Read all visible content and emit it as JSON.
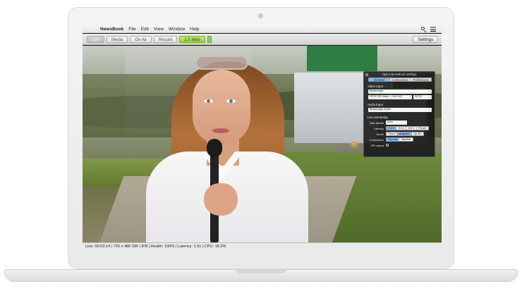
{
  "menubar": {
    "app_name": "NewsBook",
    "items": [
      "File",
      "Edit",
      "View",
      "Window",
      "Help"
    ]
  },
  "toolbar": {
    "live_label": "Live",
    "media_label": "Media",
    "on_air_label": "On Air",
    "record_label": "Record",
    "bitrate_label": "2.5 Mb/s",
    "settings_label": "Settings"
  },
  "settings_panel": {
    "title": "Tajero NewsBook Settings",
    "tabs": [
      "General",
      "Connections",
      "Preferences"
    ],
    "active_tab": "General",
    "video_input": {
      "heading": "Video input",
      "device": "Blackmagic",
      "format": "NTSC SD Video - YUV 422",
      "standard": "NTSC"
    },
    "audio_input": {
      "heading": "Audio input",
      "device": "Blackmagic Audio"
    },
    "live_streaming": {
      "heading": "Live streaming",
      "max_bitrate_label": "Max bitrate",
      "max_bitrate_value": "Auto",
      "latency_label": "Latency",
      "latency_options": [
        "1.5 s",
        "3.0 s",
        "8.0 s",
        "Preset"
      ],
      "latency_selected": "1.5 s",
      "mode_label": "Mode",
      "mode_options": [
        "Fixed",
        "Adaptive",
        "Up-Ro"
      ],
      "mode_selected": "Adaptive",
      "connection_label": "Connection",
      "connection_options": [
        "Normal",
        "Satellite"
      ],
      "connection_selected": "Normal",
      "ifb_label": "IFB output"
    }
  },
  "status": {
    "text": "Live: 00:03:14 | 720 x 480 SW | IFB | Health: 100% | Latency: 1.5s | CPU: 18.3%"
  },
  "colors": {
    "accent_blue": "#7fb4ea",
    "live_green": "#98cc4a"
  }
}
